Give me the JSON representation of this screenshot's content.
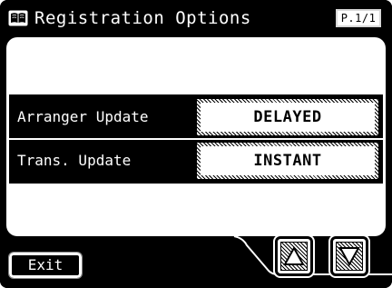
{
  "title_bar": {
    "title": "Registration Options",
    "page_indicator": "P.1/1",
    "icon": "book-icon"
  },
  "settings": {
    "rows": [
      {
        "label": "Arranger Update",
        "value": "DELAYED"
      },
      {
        "label": "Trans. Update",
        "value": "INSTANT"
      }
    ]
  },
  "footer": {
    "exit_label": "Exit",
    "up_icon": "arrow-up-icon",
    "down_icon": "arrow-down-icon"
  },
  "colors": {
    "background": "#000000",
    "panel": "#ffffff",
    "text_on_dark": "#ffffff"
  }
}
